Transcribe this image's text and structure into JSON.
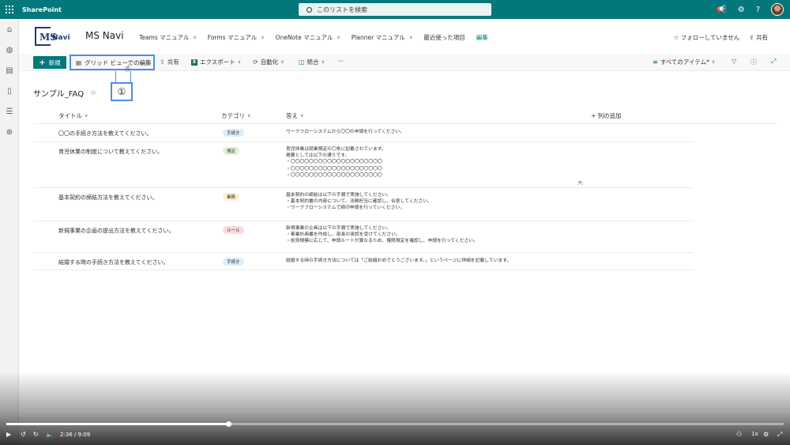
{
  "suite": {
    "brand": "SharePoint",
    "search_placeholder": "このリストを検索"
  },
  "site": {
    "title": "MS Navi",
    "logo_ms": "MS",
    "logo_navi": "Navi",
    "nav": [
      "Teams マニュアル",
      "Forms マニュアル",
      "OneNote マニュアル",
      "Planner マニュアル",
      "最近使った項目"
    ],
    "edit": "編集",
    "follow": "フォローしていません",
    "share": "共有"
  },
  "cmd": {
    "new": "新規",
    "grid_edit": "グリッド ビューでの編集",
    "share": "共有",
    "export": "エクスポート",
    "automate": "自動化",
    "integrate": "統合",
    "more": "···",
    "view": "すべてのアイテム*"
  },
  "callout": "①",
  "list": {
    "title": "サンプル_FAQ",
    "columns": {
      "title": "タイトル",
      "category": "カテゴリ",
      "answer": "答え",
      "add": "+ 列の追加"
    },
    "rows": [
      {
        "title": "〇〇の手続き方法を教えてください。",
        "category": "手続き",
        "answer": "ワークフローシステムから〇〇の申請を行ってください。"
      },
      {
        "title": "育児休業の制度について教えてください。",
        "category": "規定",
        "answer": "育児休業は就業規定の〇条に記載されています。\n概要としては以下の通りです。\n・〇〇〇〇〇〇〇〇〇〇〇〇〇〇〇〇〇〇〇〇\n・〇〇〇〇〇〇〇〇〇〇〇〇〇〇〇〇〇〇〇〇\n・〇〇〇〇〇〇〇〇〇〇〇〇〇〇〇〇〇〇〇〇"
      },
      {
        "title": "基本契約の締結方法を教えてください。",
        "category": "業務",
        "answer": "基本契約の締結は以下の手順で実施してください。\n・基本契約書の内容について、法務担当に確認し、合意してください。\n・ワークフローシステムで締印申請を行っていください。"
      },
      {
        "title": "新規事業の企画の提出方法を教えてください。",
        "category": "ルール",
        "answer": "新規事業の企画は以下の手順で実施してください。\n・事業計画書を作成し、部長の承認を受けてください。\n・投資規模に応じて、申請ルートが異なるため、権限規定を確認し、申請を行ってください。"
      },
      {
        "title": "結婚する時の手続き方法を教えてください。",
        "category": "手続き",
        "answer": "結婚する時の手続き方法については「ご結婚おめでとうございます。」というページに詳細を記載しています。"
      }
    ]
  },
  "colors": {
    "suite": "#03787c",
    "pill_procedure": "#dbeef8",
    "pill_rule_reg": "#dff3d7",
    "pill_business": "#fdf0cf",
    "pill_rule": "#fadadd",
    "highlight": "#4a90e2"
  },
  "video": {
    "time": "2:36 / 9:09",
    "speed": "1x",
    "progress": 0.2856
  }
}
